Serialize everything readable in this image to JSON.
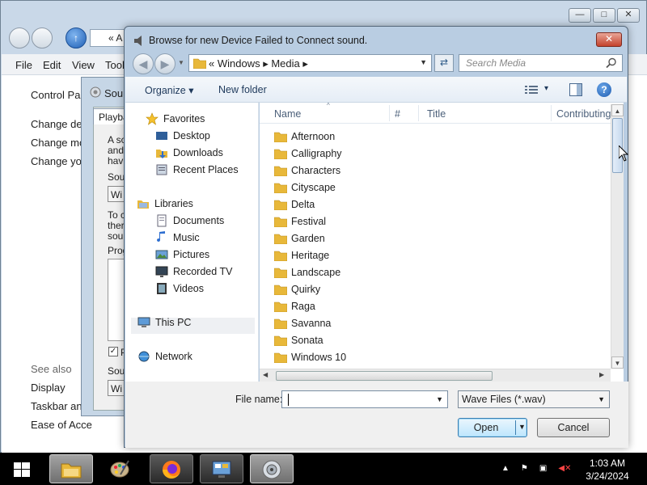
{
  "control_panel": {
    "address_fragment": "«  A",
    "menu": [
      "File",
      "Edit",
      "View",
      "Tools"
    ],
    "menu_visible": [
      "File",
      "Edit",
      "View",
      "Tool"
    ],
    "left_links": [
      "Control Pan",
      "Change des",
      "Change mo",
      "Change you"
    ],
    "see_also": "See also",
    "see_also_links": [
      "Display",
      "Taskbar and",
      "Ease of Acce"
    ]
  },
  "sound_dialog": {
    "title": "Sou",
    "tab": "Playba",
    "text_lines": [
      "A so",
      "and",
      "hav",
      "Sou",
      "Wi",
      "To c",
      "ther",
      "sou",
      "Prog",
      "Sou",
      "Wi"
    ],
    "checkbox_label": "P"
  },
  "browse_dialog": {
    "title": "Browse for new Device Failed to Connect sound.",
    "close_label": "✕",
    "address": {
      "path": [
        "Windows",
        "Media"
      ],
      "display": "«  Windows  ▸  Media  ▸"
    },
    "search_placeholder": "Search Media",
    "toolbar": {
      "organize": "Organize ▾",
      "new_folder": "New folder",
      "view_arrow": "▾",
      "help": "?"
    },
    "nav": {
      "favorites": "Favorites",
      "favorite_items": [
        "Desktop",
        "Downloads",
        "Recent Places"
      ],
      "libraries": "Libraries",
      "library_items": [
        "Documents",
        "Music",
        "Pictures",
        "Recorded TV",
        "Videos"
      ],
      "this_pc": "This PC",
      "network": "Network"
    },
    "columns": [
      "Name",
      "#",
      "Title",
      "Contributing"
    ],
    "folders": [
      "Afternoon",
      "Calligraphy",
      "Characters",
      "Cityscape",
      "Delta",
      "Festival",
      "Garden",
      "Heritage",
      "Landscape",
      "Quirky",
      "Raga",
      "Savanna",
      "Sonata",
      "Windows 10"
    ],
    "file_name_label": "File name:",
    "file_name_value": "",
    "file_type": "Wave Files (*.wav)",
    "open_label": "Open",
    "cancel_label": "Cancel"
  },
  "taskbar": {
    "time": "1:03 AM",
    "date": "3/24/2024",
    "tasks": [
      "file-explorer",
      "paint",
      "firefox",
      "control-panel",
      "sound"
    ]
  },
  "colors": {
    "folder": "#e8b83a",
    "accent": "#3c7fb1",
    "close": "#c4422c"
  }
}
